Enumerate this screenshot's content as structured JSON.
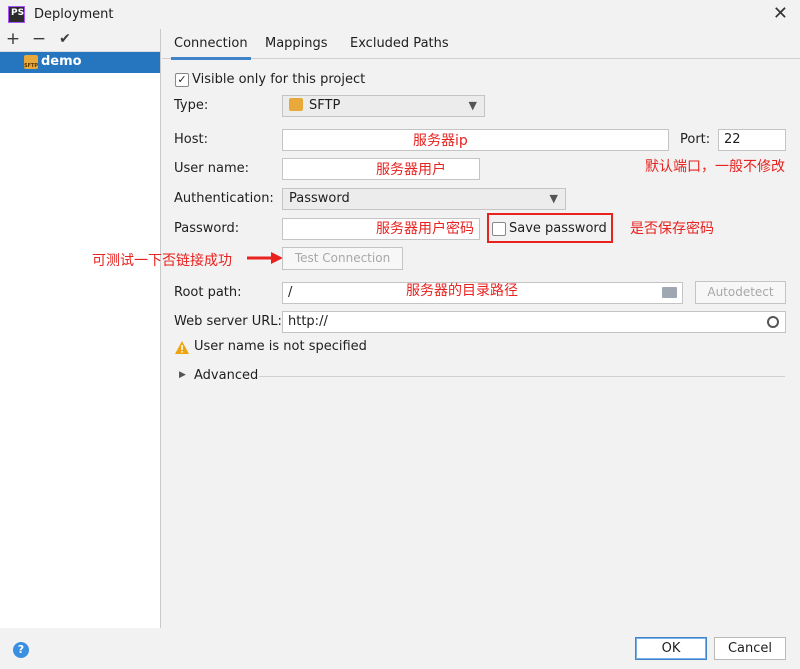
{
  "window": {
    "title": "Deployment",
    "logo": "PS",
    "close": "✕"
  },
  "left": {
    "toolbar": {
      "add": "+",
      "remove": "−",
      "default": "✔"
    },
    "server": "demo",
    "server_icon_text": "SFTP"
  },
  "tabs": [
    "Connection",
    "Mappings",
    "Excluded Paths"
  ],
  "form": {
    "visible_only": "Visible only for this project",
    "type_label": "Type:",
    "type_value": "SFTP",
    "host_label": "Host:",
    "host_value": "",
    "port_label": "Port:",
    "port_value": "22",
    "username_label": "User name:",
    "username_value": "",
    "auth_label": "Authentication:",
    "auth_value": "Password",
    "password_label": "Password:",
    "password_value": "",
    "save_password": "Save password",
    "test_connection": "Test Connection",
    "root_label": "Root path:",
    "root_value": "/",
    "autodetect": "Autodetect",
    "url_label": "Web server URL:",
    "url_value": "http://",
    "warning": "User name is not specified",
    "advanced": "Advanced"
  },
  "annotations": {
    "host": "服务器ip",
    "port": "默认端口，一般不修改",
    "username": "服务器用户",
    "password": "服务器用户密码",
    "save": "是否保存密码",
    "test": "可测试一下否链接成功",
    "root": "服务器的目录路径"
  },
  "footer": {
    "help": "?",
    "ok": "OK",
    "cancel": "Cancel"
  },
  "colors": {
    "selection": "#2675bf",
    "annotation": "#e8221f",
    "tab_underline": "#4083c9"
  }
}
